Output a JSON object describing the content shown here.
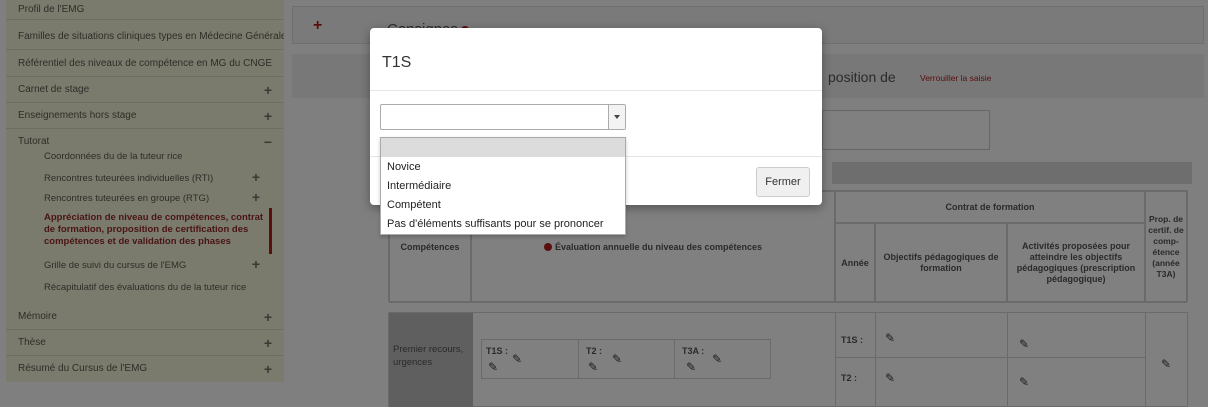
{
  "sidebar": {
    "items": [
      {
        "label": "Profil de l'EMG",
        "has_plus": false
      },
      {
        "label": "Familles de situations cliniques types en Médecine Générale",
        "has_plus": false
      },
      {
        "label": "Référentiel des niveaux de compétence en MG du CNGE",
        "has_plus": false
      },
      {
        "label": "Carnet de stage",
        "has_plus": true
      },
      {
        "label": "Enseignements hors stage",
        "has_plus": true
      },
      {
        "label": "Tutorat",
        "toggle": "−"
      }
    ],
    "tutorat_sub": [
      {
        "label": "Coordonnées du de la tuteur rice",
        "toggle": ""
      },
      {
        "label": "Rencontres tuteurées individuelles (RTI)",
        "toggle": "+"
      },
      {
        "label": "Rencontres tuteurées en groupe (RTG)",
        "toggle": "+"
      }
    ],
    "active_sub": "Appréciation de niveau de compétences, contrat de formation, proposition de certification des compétences et de validation des phases",
    "tutorat_sub_after": [
      {
        "label": "Grille de suivi du cursus de l'EMG",
        "toggle": "+"
      },
      {
        "label": "Récapitulatif des évaluations du de la tuteur rice",
        "toggle": ""
      }
    ],
    "bottom_items": [
      {
        "label": "Mémoire",
        "toggle": "+"
      },
      {
        "label": "Thèse",
        "toggle": "+"
      },
      {
        "label": "Résumé du Cursus de l'EMG",
        "toggle": "+"
      }
    ]
  },
  "main": {
    "consignes_plus": "+",
    "consignes_title": "Consignes",
    "proposition_text": "position de",
    "lock_link": "Verrouiller la saisie"
  },
  "table": {
    "competences_header": "Compétences",
    "evaluation_header": "Évaluation annuelle du niveau des compétences",
    "contrat_header": "Contrat de formation",
    "annee_header": "Année",
    "objectifs_header": "Objectifs pédagogiques de formation",
    "activites_header": "Activités proposées pour atteindre les objectifs pédagogiques (prescription pédagogique)",
    "prop_header": "Prop. de certif. de comp-étence (année T3A)",
    "row1_label": "Premier recours, urgences",
    "eval_labels": [
      "T1S :",
      "T2 :",
      "T3A :"
    ],
    "year_labels": [
      "T1S :",
      "T2 :"
    ]
  },
  "modal": {
    "title": "T1S",
    "select_value": "",
    "options": [
      "",
      "Novice",
      "Intermédiaire",
      "Compétent",
      "Pas d'éléments suffisants pour se prononcer"
    ],
    "close_label": "Fermer"
  },
  "colors": {
    "accent": "#8b1a1a",
    "overlay": "rgba(0,0,0,0.5)"
  }
}
